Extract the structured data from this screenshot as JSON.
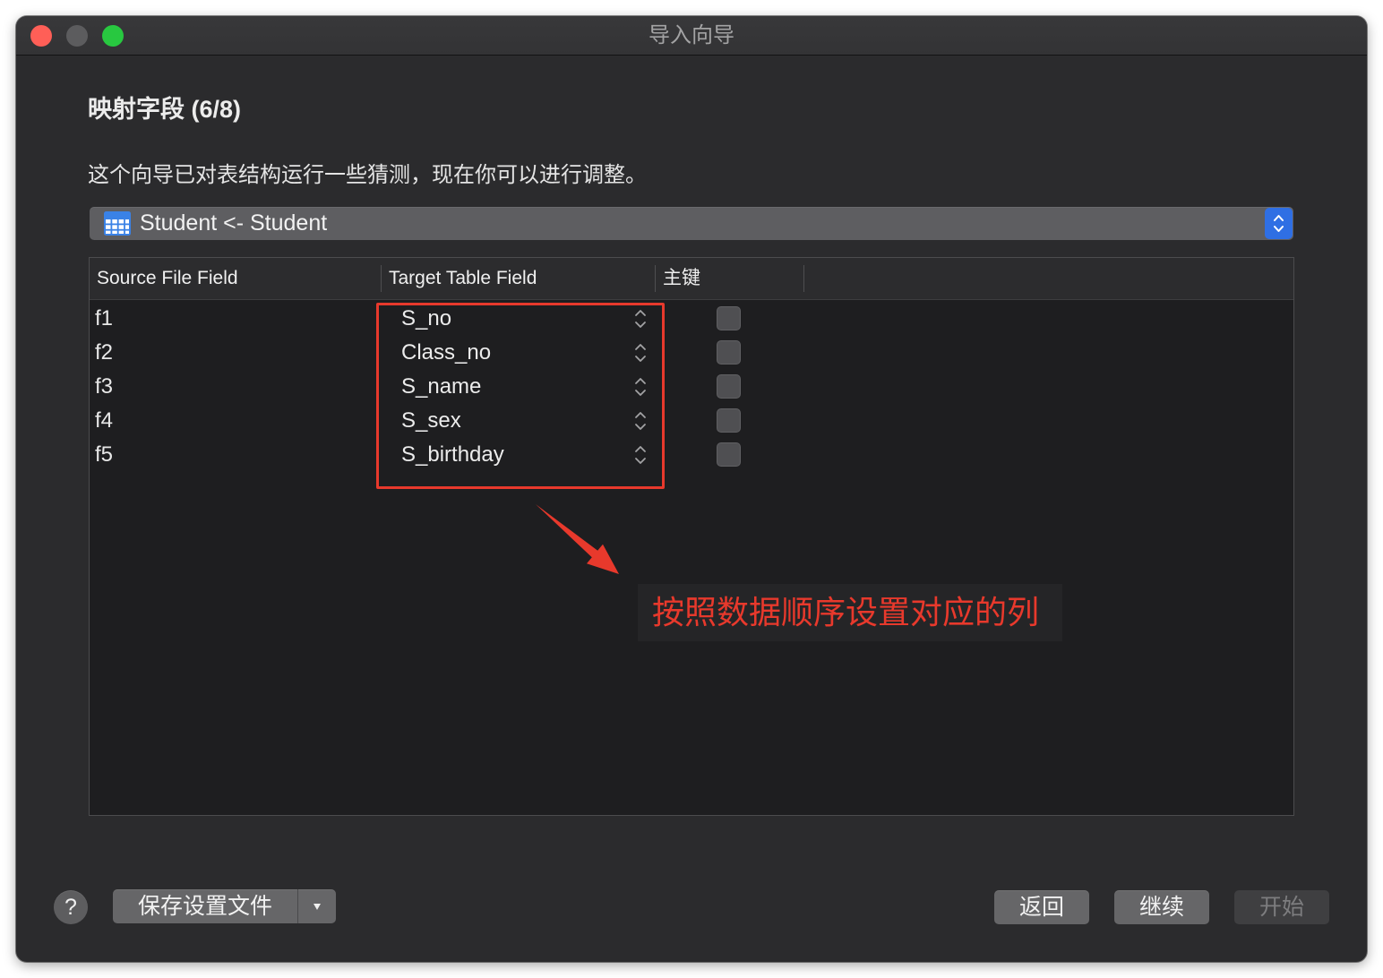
{
  "window": {
    "title": "导入向导"
  },
  "step": {
    "heading": "映射字段 (6/8)",
    "description": "这个向导已对表结构运行一些猜测，现在你可以进行调整。"
  },
  "table_selector": {
    "value": "Student <- Student",
    "icon": "table-icon",
    "stepper_icon": "up-down-chevron-icon"
  },
  "mapping_table": {
    "columns": {
      "source": "Source File Field",
      "target": "Target Table Field",
      "primary_key": "主键"
    },
    "rows": [
      {
        "source": "f1",
        "target": "S_no",
        "primary_key": false
      },
      {
        "source": "f2",
        "target": "Class_no",
        "primary_key": false
      },
      {
        "source": "f3",
        "target": "S_name",
        "primary_key": false
      },
      {
        "source": "f4",
        "target": "S_sex",
        "primary_key": false
      },
      {
        "source": "f5",
        "target": "S_birthday",
        "primary_key": false
      }
    ],
    "target_popup_icon": "up-down-chevron-icon"
  },
  "annotation": {
    "text": "按照数据顺序设置对应的列"
  },
  "footer": {
    "help_label": "?",
    "save_settings_label": "保存设置文件",
    "save_settings_menu_icon": "triangle-down-icon",
    "back_label": "返回",
    "continue_label": "继续",
    "start_label": "开始",
    "start_enabled": false
  },
  "colors": {
    "close_light": "#ff5f57",
    "minimize_light": "#5c5c5e",
    "zoom_light": "#28c840",
    "accent": "#2f6fe4",
    "annotation": "#e8392c",
    "window_background": "#2b2b2d",
    "table_background": "#1e1e20"
  }
}
